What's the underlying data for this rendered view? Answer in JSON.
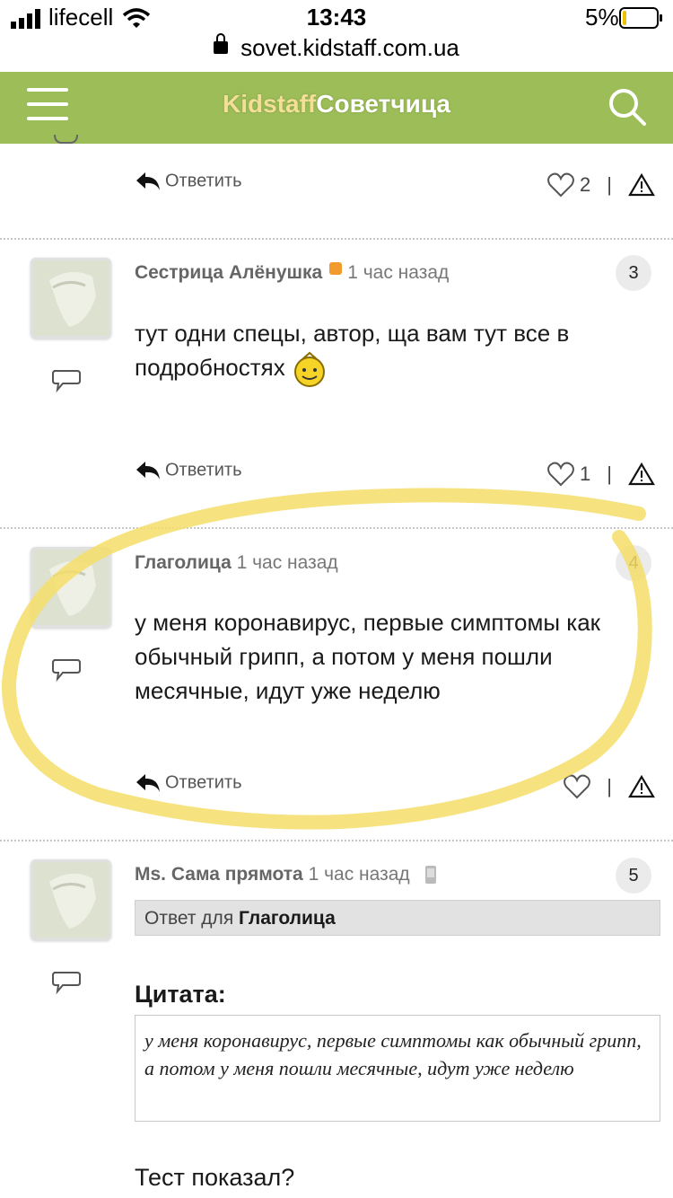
{
  "status_bar": {
    "carrier": "lifecell",
    "time": "13:43",
    "battery": "5%",
    "url": "sovet.kidstaff.com.ua"
  },
  "header": {
    "logo_part1": "Kidstaff",
    "logo_part2": "Советчица"
  },
  "comments": [
    {
      "reply": "Ответить",
      "likes": "2"
    },
    {
      "author": "Сестрица Алёнушка",
      "time": "1 час назад",
      "number": "3",
      "text": "тут одни спецы, автор, ща вам тут все в подробностях",
      "reply": "Ответить",
      "likes": "1"
    },
    {
      "author": "Глаголица",
      "time": "1 час назад",
      "number": "4",
      "text": "у меня коронавирус, первые симптомы как обычный грипп, а потом у меня пошли месячные, идут уже неделю",
      "reply": "Ответить",
      "likes": ""
    },
    {
      "author": "Ms. Сама прямота",
      "time": "1 час назад",
      "number": "5",
      "reply_to_label": "Ответ для",
      "reply_to_name": "Глаголица",
      "quote_title": "Цитата:",
      "quote_text": "у меня коронавирус, первые симптомы как обычный грипп, а потом у меня пошли месячные, идут уже неделю",
      "text": "Тест показал?"
    }
  ],
  "colors": {
    "header": "#9cbd58",
    "highlight": "#f5de6a",
    "badge_dot": "#f29a2e"
  },
  "icons": [
    "hamburger-icon",
    "search-icon",
    "reply-arrow-icon",
    "heart-icon",
    "warning-icon",
    "chat-bubble-icon",
    "smiley-icon",
    "phone-icon"
  ]
}
